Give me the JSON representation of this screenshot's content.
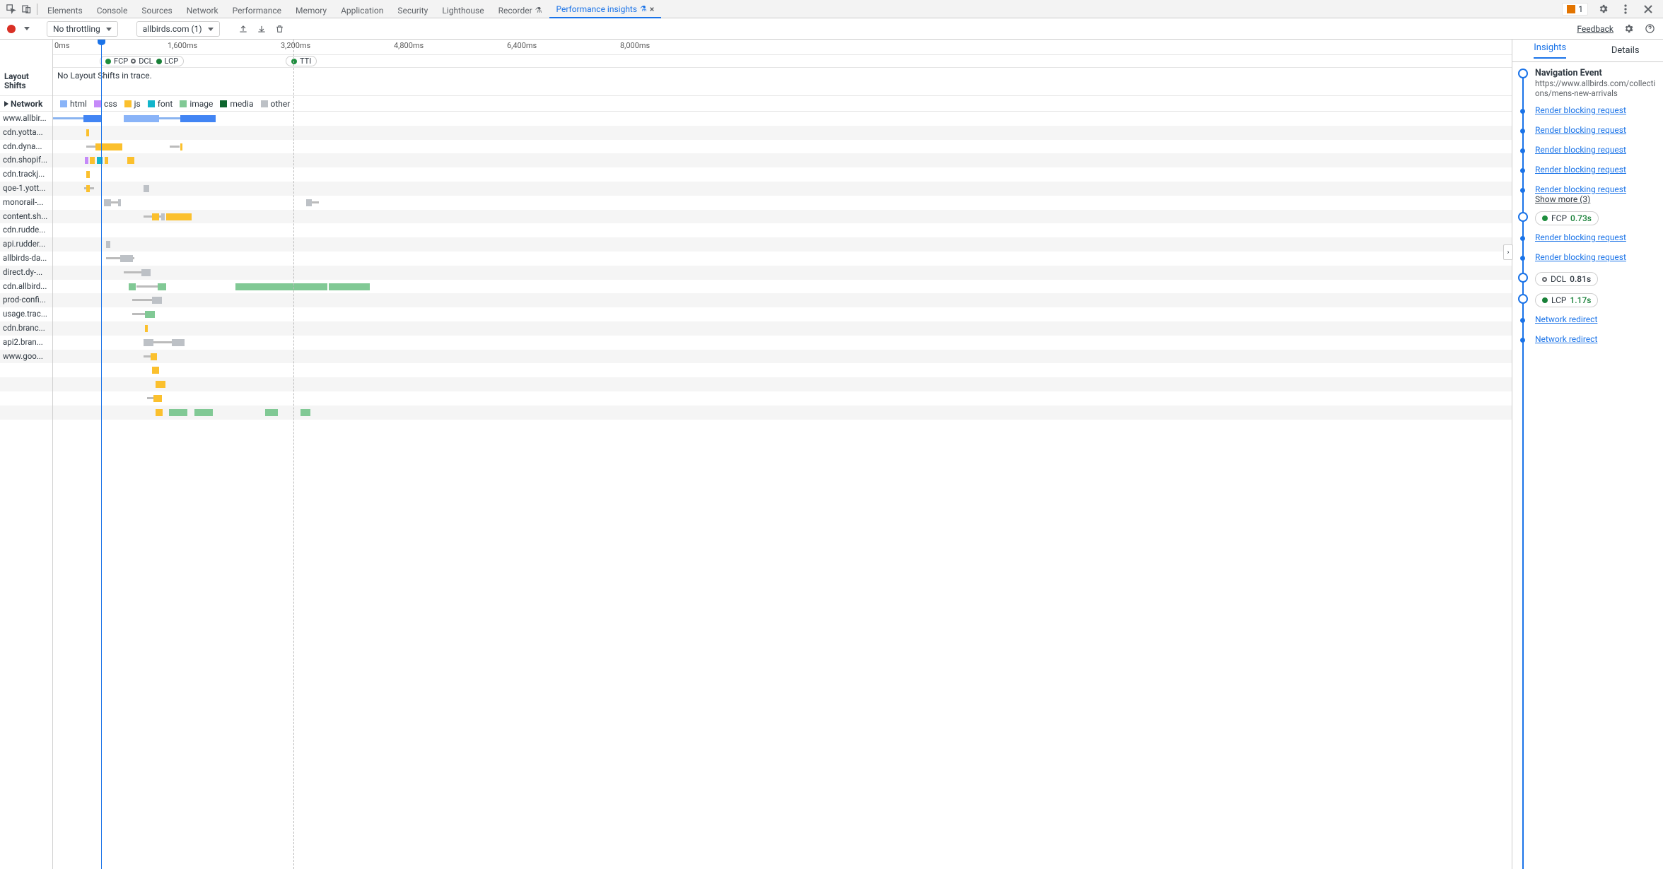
{
  "tabs": [
    "Elements",
    "Console",
    "Sources",
    "Network",
    "Performance",
    "Memory",
    "Application",
    "Security",
    "Lighthouse",
    "Recorder",
    "Performance insights"
  ],
  "activeTab": "Performance insights",
  "issueCount": "1",
  "toolbar": {
    "throttle": "No throttling",
    "page": "allbirds.com (1)",
    "feedback": "Feedback"
  },
  "ruler": [
    "0ms",
    "1,600ms",
    "3,200ms",
    "4,800ms",
    "6,400ms",
    "8,000ms"
  ],
  "markers": {
    "fcp": "FCP",
    "dcl": "DCL",
    "lcp": "LCP",
    "tti": "TTI"
  },
  "layoutShifts": {
    "label": "Layout Shifts",
    "msg": "No Layout Shifts in trace."
  },
  "networkSection": {
    "label": "Network"
  },
  "legend": {
    "html": "html",
    "css": "css",
    "js": "js",
    "font": "font",
    "image": "image",
    "media": "media",
    "other": "other"
  },
  "hosts": [
    "www.allbir...",
    "cdn.yotta...",
    "cdn.dyna...",
    "cdn.shopif...",
    "cdn.trackj...",
    "qoe-1.yott...",
    "monorail-...",
    "content.sh...",
    "cdn.rudde...",
    "api.rudder...",
    "allbirds-da...",
    "direct.dy-...",
    "cdn.allbird...",
    "prod-confi...",
    "usage.trac...",
    "cdn.branc...",
    "api2.bran...",
    "www.goo...",
    "",
    "",
    "",
    ""
  ],
  "sidebarTabs": {
    "insights": "Insights",
    "details": "Details"
  },
  "insights": {
    "navTitle": "Navigation Event",
    "navUrl": "https://www.allbirds.com/collections/mens-new-arrivals",
    "rbr": "Render blocking request",
    "showMore": "Show more (3)",
    "fcpPill": {
      "label": "FCP",
      "time": "0.73s"
    },
    "dclPill": {
      "label": "DCL",
      "time": "0.81s"
    },
    "lcpPill": {
      "label": "LCP",
      "time": "1.17s"
    },
    "netRedirect": "Network redirect"
  }
}
